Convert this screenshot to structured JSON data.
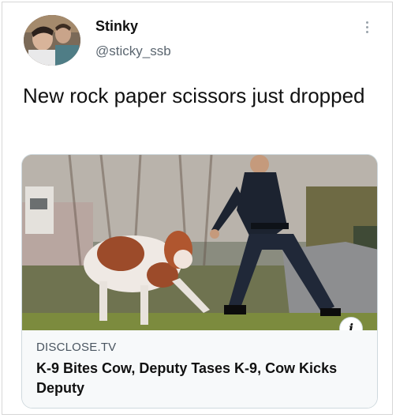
{
  "author": {
    "name": "Stinky",
    "handle": "@sticky_ssb",
    "avatar_icon": "profile-photo"
  },
  "tweet": {
    "text": "New rock paper scissors just dropped"
  },
  "card": {
    "domain": "DISCLOSE.TV",
    "headline": "K-9 Bites Cow, Deputy Tases K-9, Cow Kicks Deputy",
    "info_label": "i"
  },
  "icons": {
    "more": "more-vertical-icon",
    "info": "info-icon"
  }
}
